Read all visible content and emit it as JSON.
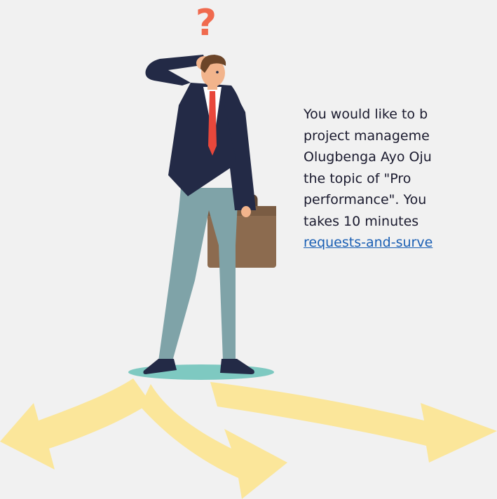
{
  "survey_invite": {
    "lines": [
      "You would like to b",
      "project  manageme",
      "Olugbenga Ayo Oju",
      "the  topic  of  \"Pro",
      "performance\". You",
      "takes  10  minutes"
    ],
    "link_text": "requests-and-surve"
  },
  "illustration": {
    "question_mark": "?",
    "colors": {
      "background": "#f1f1f1",
      "arrows": "#fbe69a",
      "suit": "#232a46",
      "trousers": "#7fa3a8",
      "tie": "#e8473b",
      "briefcase": "#8c6b4f",
      "platform": "#7ec9c1",
      "question_mark": "#f06a4e",
      "link": "#1a5fb4"
    }
  }
}
